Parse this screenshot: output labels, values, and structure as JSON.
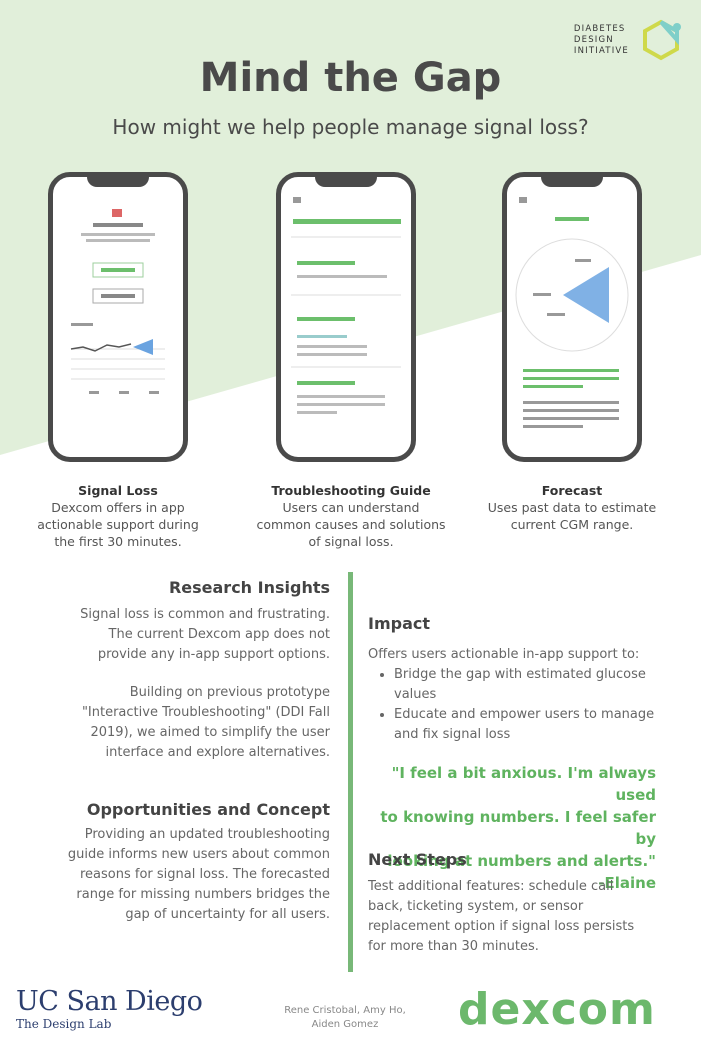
{
  "brand": {
    "initiative_line1": "DIABETES",
    "initiative_line2": "DESIGN",
    "initiative_line3": "INITIATIVE"
  },
  "header": {
    "title": "Mind the Gap",
    "subtitle": "How might we help people manage signal loss?"
  },
  "phones": [
    {
      "name": "Signal Loss",
      "desc_line1": "Dexcom offers in app",
      "desc_line2": "actionable support during",
      "desc_line3": "the first 30 minutes."
    },
    {
      "name": "Troubleshooting Guide",
      "desc_line1": "Users can understand",
      "desc_line2": "common causes and solutions",
      "desc_line3": "of signal loss."
    },
    {
      "name": "Forecast",
      "desc_line1": "Uses past data to estimate",
      "desc_line2": "current CGM range.",
      "desc_line3": ""
    }
  ],
  "left": {
    "research_heading": "Research Insights",
    "research_p1": [
      "Signal loss is common and frustrating.",
      "The current Dexcom app does not",
      "provide any in-app support options."
    ],
    "research_p2": [
      "Building on previous prototype",
      "\"Interactive Troubleshooting\" (DDI Fall",
      "2019), we aimed to simplify the user",
      "interface and explore alternatives."
    ],
    "opp_heading": "Opportunities and Concept",
    "opp_p": [
      "Providing an updated troubleshooting",
      "guide informs new users about common",
      "reasons for signal loss. The forecasted",
      "range for missing numbers bridges the",
      "gap of uncertainty for all users."
    ]
  },
  "right": {
    "impact_heading": "Impact",
    "impact_intro": "Offers users actionable in-app support to:",
    "impact_bullets": [
      "Bridge the gap with estimated glucose values",
      "Educate and empower users to manage and fix signal loss"
    ],
    "quote_lines": [
      "\"I feel a bit anxious. I'm always used",
      "to knowing numbers. I feel safer by",
      "looking at numbers and alerts.\"",
      "-Elaine"
    ],
    "next_heading": "Next Steps",
    "next_p": [
      "Test additional features: schedule call",
      "back, ticketing system, or sensor",
      "replacement option if signal loss persists",
      "for more than 30 minutes."
    ]
  },
  "footer": {
    "ucsd_line1": "UC San Diego",
    "ucsd_line2": "The Design Lab",
    "credits_line1": "Rene Cristobal, Amy Ho,",
    "credits_line2": "Aiden Gomez",
    "dexcom": "dexcom"
  },
  "colors": {
    "accent_green": "#5fb35f",
    "bg_green": "#e1efda",
    "divider": "#78b878"
  }
}
